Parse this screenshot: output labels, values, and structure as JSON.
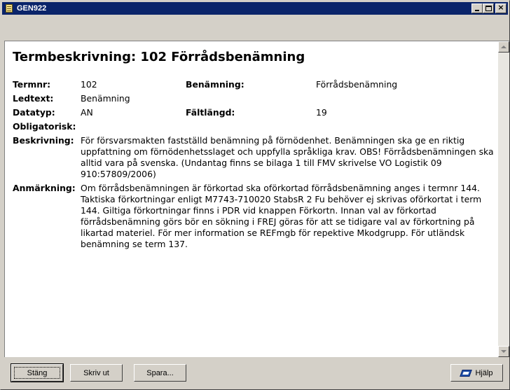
{
  "window": {
    "title": "GEN922"
  },
  "document": {
    "heading": "Termbeskrivning: 102 Förrådsbenämning",
    "termnr_label": "Termnr:",
    "termnr_value": "102",
    "benamning_label": "Benämning:",
    "benamning_value": "Förrådsbenämning",
    "ledtext_label": "Ledtext:",
    "ledtext_value": "Benämning",
    "datatyp_label": "Datatyp:",
    "datatyp_value": "AN",
    "faltlangd_label": "Fältlängd:",
    "faltlangd_value": "19",
    "obligatorisk_label": "Obligatorisk:",
    "beskrivning_label": "Beskrivning:",
    "beskrivning_value": "För försvarsmakten fastställd benämning på förnödenhet. Benämningen ska ge en riktig uppfattning om förnödenhetsslaget och uppfylla språkliga krav. OBS! Förrådsbenämningen ska alltid vara på svenska. (Undantag finns se bilaga 1 till FMV skrivelse VO Logistik 09 910:57809/2006)",
    "anmarkning_label": "Anmärkning:",
    "anmarkning_value": "Om förrådsbenämningen är förkortad ska oförkortad förrådsbenämning anges i termnr 144. Taktiska förkortningar enligt M7743-710020 StabsR 2 Fu behöver ej skrivas oförkortat i term 144. Giltiga förkortningar finns i PDR vid knappen Förkortn. Innan val av förkortad förrådsbenämning görs bör en sökning i FREJ göras för att se tidigare val av förkortning på likartad materiel. För mer information se REFmgb för repektive Mkodgrupp. För utländsk benämning se term 137."
  },
  "buttons": {
    "close": "Stäng",
    "print": "Skriv ut",
    "save": "Spara...",
    "help": "Hjälp"
  },
  "icons": {
    "app": "document-icon",
    "help": "help-book-icon"
  }
}
